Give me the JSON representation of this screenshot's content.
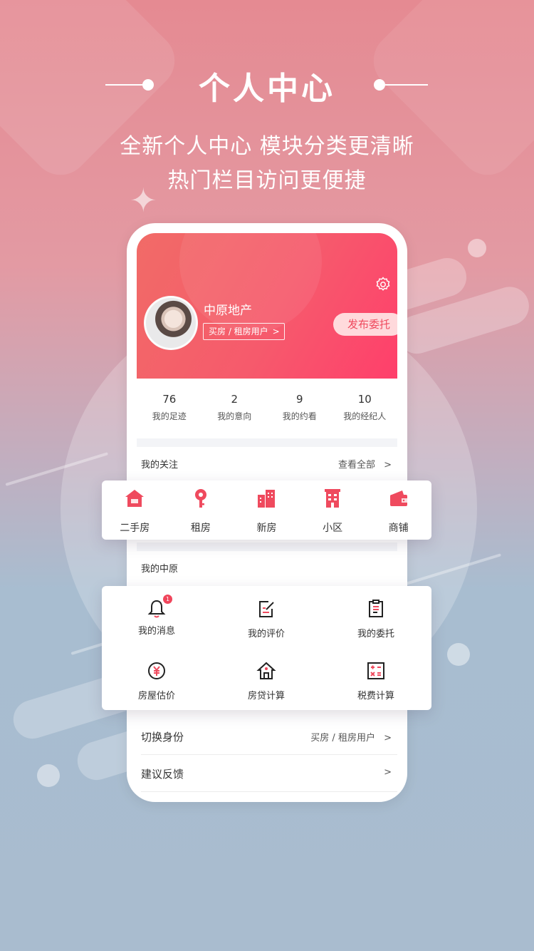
{
  "banner": {
    "title": "个人中心",
    "subtitle_line1": "全新个人中心  模块分类更清晰",
    "subtitle_line2": "热门栏目访问更便捷"
  },
  "profile": {
    "name": "中原地产",
    "role_label": "买房 / 租房用户",
    "role_chevron": ">",
    "publish_button": "发布委托",
    "settings_icon": "gear-icon"
  },
  "stats": [
    {
      "value": "76",
      "label": "我的足迹"
    },
    {
      "value": "2",
      "label": "我的意向"
    },
    {
      "value": "9",
      "label": "我的约看"
    },
    {
      "value": "10",
      "label": "我的经纪人"
    }
  ],
  "follow_section": {
    "title": "我的关注",
    "more_label": "查看全部",
    "items": [
      {
        "label": "二手房",
        "icon": "house-icon"
      },
      {
        "label": "租房",
        "icon": "key-pin-icon"
      },
      {
        "label": "新房",
        "icon": "buildings-icon"
      },
      {
        "label": "小区",
        "icon": "apartment-icon"
      },
      {
        "label": "商铺",
        "icon": "wallet-icon"
      }
    ]
  },
  "my_section": {
    "title": "我的中原",
    "items": [
      {
        "label": "我的消息",
        "icon": "bell-icon",
        "badge": "1"
      },
      {
        "label": "我的评价",
        "icon": "edit-note-icon"
      },
      {
        "label": "我的委托",
        "icon": "clipboard-icon"
      },
      {
        "label": "房屋估价",
        "icon": "yen-coin-icon"
      },
      {
        "label": "房贷计算",
        "icon": "home-loan-icon"
      },
      {
        "label": "税费计算",
        "icon": "calculator-icon"
      }
    ]
  },
  "list": [
    {
      "label": "切换身份",
      "value": "买房 / 租房用户"
    },
    {
      "label": "建议反馈",
      "value": ""
    }
  ],
  "chevron": ">",
  "colors": {
    "accent": "#ef4a5e",
    "hero_start": "#f16b67",
    "hero_end": "#ff3f6b"
  }
}
